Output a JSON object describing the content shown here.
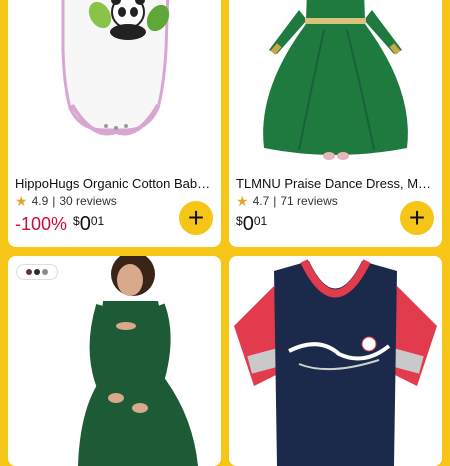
{
  "products": [
    {
      "title": "HippoHugs Organic Cotton Baby …",
      "rating": "4.9",
      "reviews": "30 reviews",
      "discount": "-100%",
      "price_symbol": "$",
      "price_whole": "0",
      "price_fraction": "01",
      "add_label": "+"
    },
    {
      "title": "TLMNU Praise Dance Dress, Metal…",
      "rating": "4.7",
      "reviews": "71 reviews",
      "discount": "",
      "price_symbol": "$",
      "price_whole": "0",
      "price_fraction": "01",
      "add_label": "+"
    }
  ],
  "swatch_colors": [
    "#6b2f3a",
    "#2a2a2a",
    "#8a8a8a"
  ],
  "colors": {
    "background": "#f5c518",
    "discount": "#cc0c39",
    "star": "#e3a52e",
    "dress_green": "#1f7a3f",
    "maternity_green": "#1d5a36",
    "tee_navy": "#1b2a4a",
    "tee_red": "#e23b4d"
  },
  "icons": {
    "star": "star-icon",
    "add": "plus-icon"
  }
}
